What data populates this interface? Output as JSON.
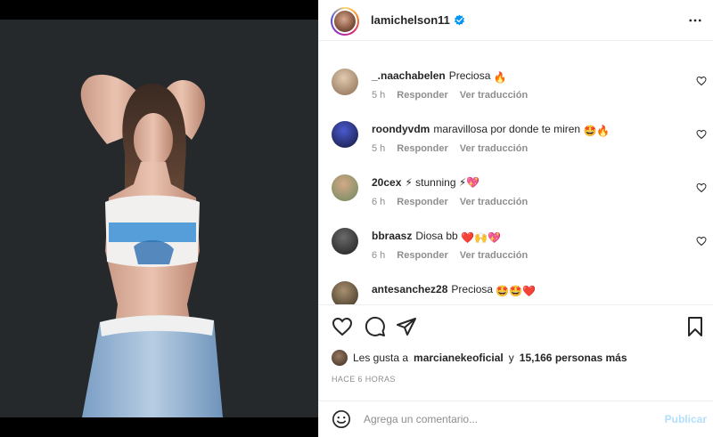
{
  "post": {
    "username": "lamichelson11",
    "verified": true,
    "likes_prefix": "Les gusta a",
    "likes_user": "marcianekeoficial",
    "likes_conj": "y",
    "likes_count": "15,166 personas más",
    "timestamp": "HACE 6 HORAS"
  },
  "comments": [
    {
      "username": "_.naachabelen",
      "text": "Preciosa",
      "emojis": "🔥",
      "time": "5 h",
      "reply": "Responder",
      "translate": "Ver traducción"
    },
    {
      "username": "roondyvdm",
      "text": "maravillosa por donde te miren",
      "emojis": "🤩🔥",
      "time": "5 h",
      "reply": "Responder",
      "translate": "Ver traducción"
    },
    {
      "username": "20cex",
      "text": "⚡ stunning ⚡💖",
      "emojis": "",
      "time": "6 h",
      "reply": "Responder",
      "translate": "Ver traducción"
    },
    {
      "username": "bbraasz",
      "text": "Diosa bb",
      "emojis": "❤️🙌💖",
      "time": "6 h",
      "reply": "Responder",
      "translate": "Ver traducción"
    },
    {
      "username": "antesanchez28",
      "text": "Preciosa",
      "emojis": "🤩🤩❤️",
      "time": "",
      "reply": "",
      "translate": ""
    }
  ],
  "composer": {
    "placeholder": "Agrega un comentario...",
    "publish_label": "Publicar"
  },
  "icons": {
    "like": "heart-icon",
    "comment": "comment-icon",
    "share": "share-icon",
    "save": "bookmark-icon",
    "more": "more-options-icon",
    "emoji": "emoji-icon",
    "verified": "verified-badge-icon"
  },
  "colors": {
    "verified_blue": "#0095f6",
    "publish_disabled": "#b2dffc",
    "meta_gray": "#8e8e8e"
  }
}
